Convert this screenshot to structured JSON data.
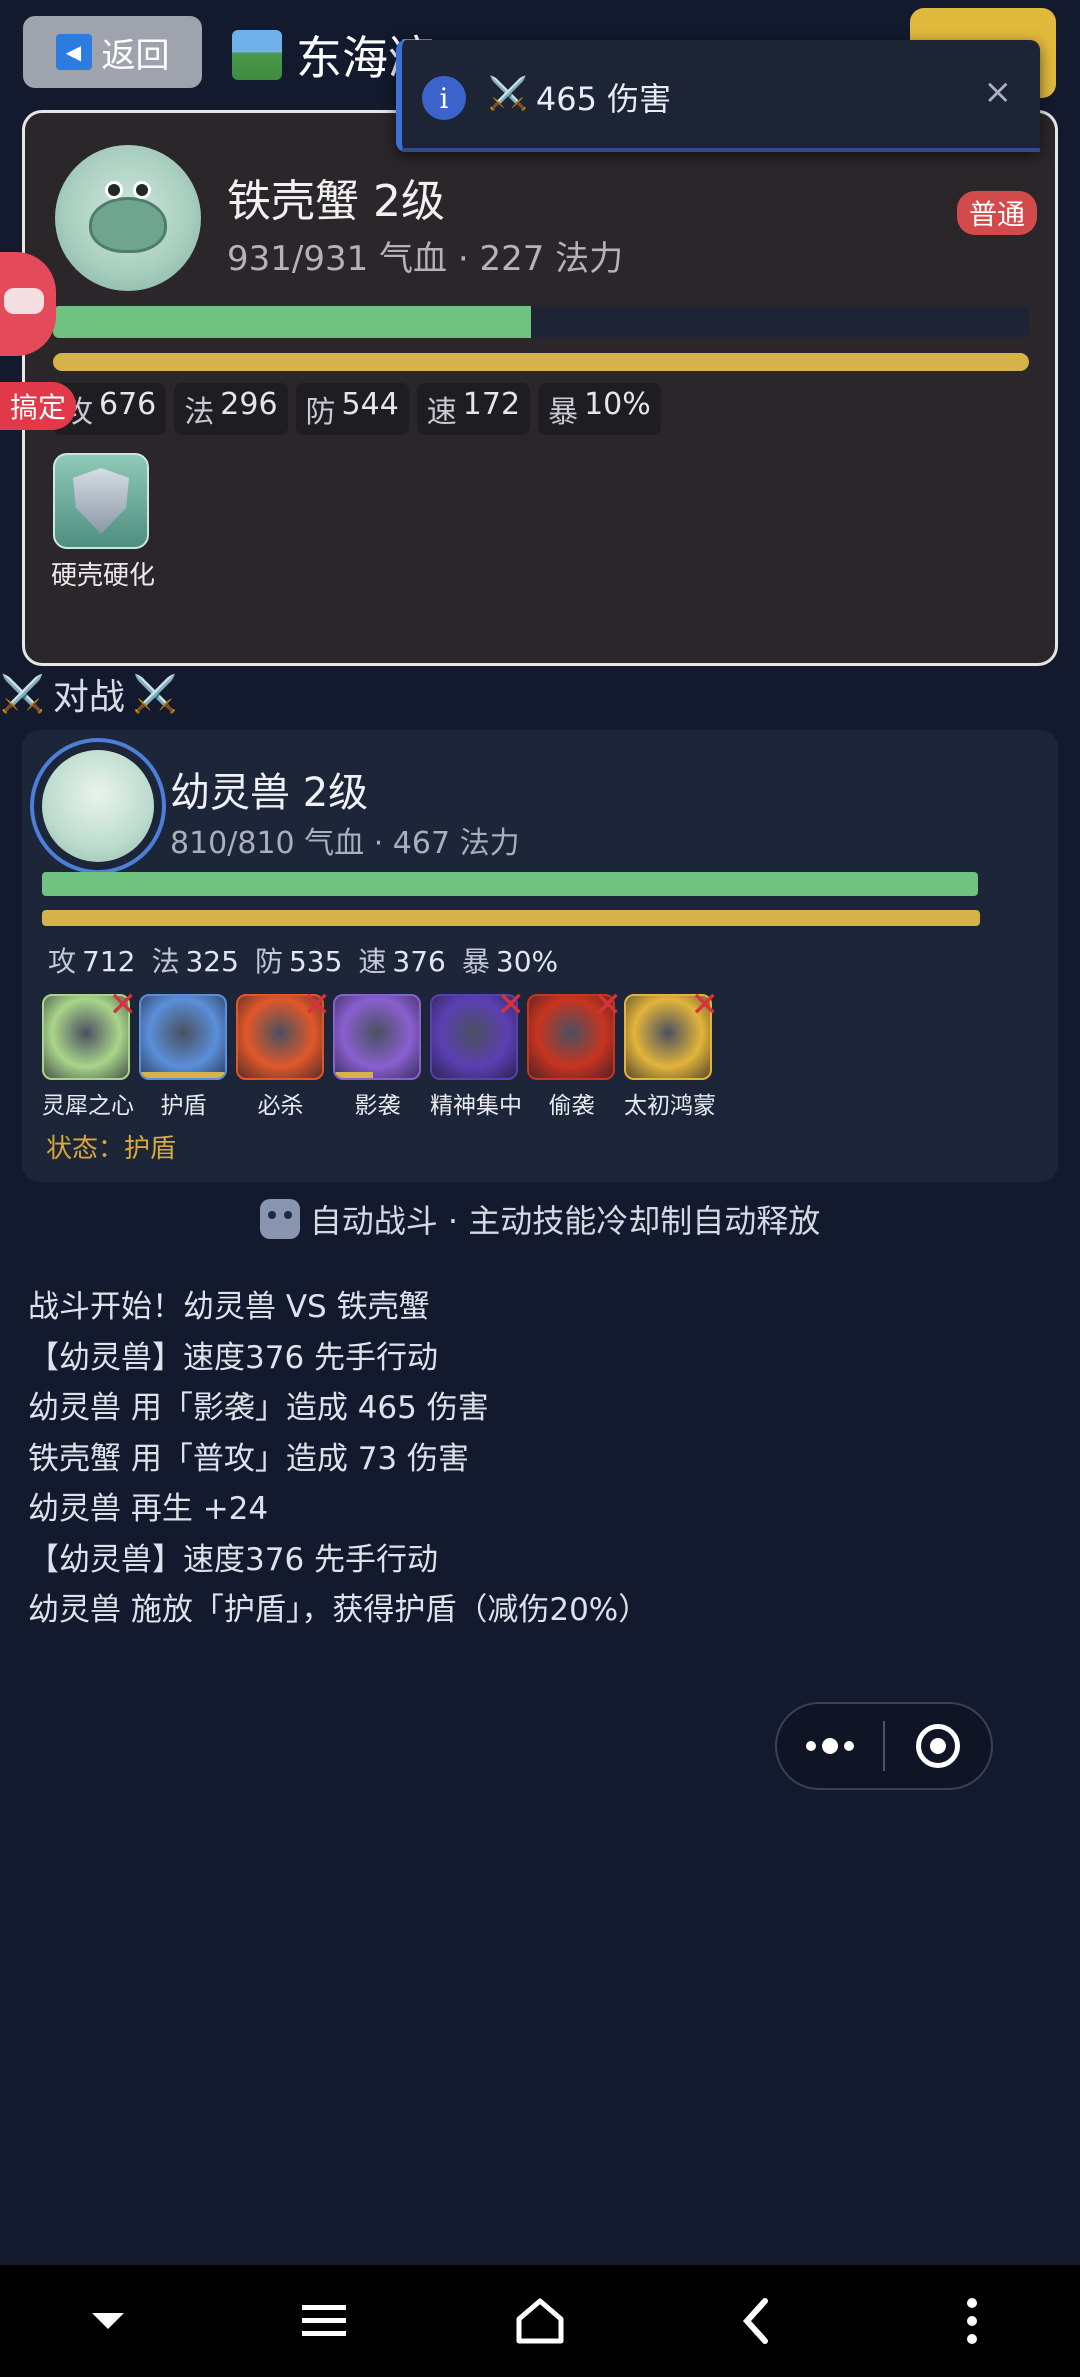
{
  "topbar": {
    "back_label": "返回",
    "map_name": "东海湾"
  },
  "toast": {
    "message_icon": "⚔️",
    "message": "465 伤害",
    "close": "×"
  },
  "enemy": {
    "name": "铁壳蟹 2级",
    "hp_mp": "931/931 气血 · 227 法力",
    "rank": "普通",
    "hp_fraction": 0.49,
    "stats": [
      {
        "k": "攻",
        "v": "676"
      },
      {
        "k": "法",
        "v": "296"
      },
      {
        "k": "防",
        "v": "544"
      },
      {
        "k": "速",
        "v": "172"
      },
      {
        "k": "暴",
        "v": "10%"
      }
    ],
    "skill_label": "硬壳硬化"
  },
  "mascot": {
    "tag": "搞定"
  },
  "battle_label": "对战",
  "player": {
    "name": "幼灵兽 2级",
    "hp_mp": "810/810 气血 · 467 法力",
    "stats": [
      {
        "k": "攻",
        "v": "712"
      },
      {
        "k": "法",
        "v": "325"
      },
      {
        "k": "防",
        "v": "535"
      },
      {
        "k": "速",
        "v": "376"
      },
      {
        "k": "暴",
        "v": "30%"
      }
    ],
    "skills": [
      {
        "label": "灵犀之心",
        "icon": "clover-icon",
        "color": "#a9d58a",
        "disabled": true
      },
      {
        "label": "护盾",
        "icon": "shield-icon",
        "color": "#5a8fd9",
        "disabled": false
      },
      {
        "label": "必杀",
        "icon": "explosion-icon",
        "color": "#e0582a",
        "disabled": true
      },
      {
        "label": "影袭",
        "icon": "shadow-strike-icon",
        "color": "#8a5fd0",
        "disabled": false
      },
      {
        "label": "精神集中",
        "icon": "focus-icon",
        "color": "#5b3fb3",
        "disabled": true
      },
      {
        "label": "偷袭",
        "icon": "sneak-attack-icon",
        "color": "#c8341f",
        "disabled": true
      },
      {
        "label": "太初鸿蒙",
        "icon": "fortune-icon",
        "color": "#e2b43b",
        "disabled": true
      }
    ],
    "status_label": "状态：",
    "status_value": "护盾"
  },
  "auto_battle": "自动战斗 · 主动技能冷却制自动释放",
  "log": [
    "战斗开始！幼灵兽 VS 铁壳蟹",
    "【幼灵兽】速度376 先手行动",
    "幼灵兽 用「影袭」造成 465 伤害",
    "铁壳蟹 用「普攻」造成 73 伤害",
    "幼灵兽 再生 +24",
    "【幼灵兽】速度376 先手行动",
    "幼灵兽 施放「护盾」，获得护盾（减伤20%）"
  ]
}
